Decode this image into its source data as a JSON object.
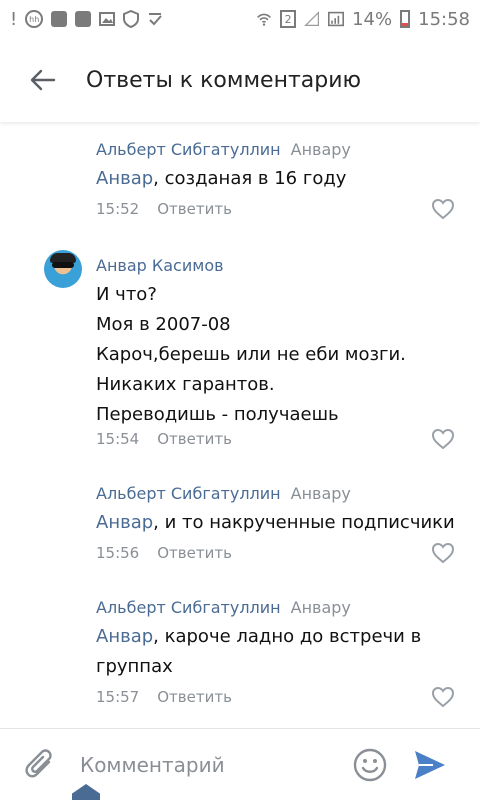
{
  "status_bar": {
    "battery": "14%",
    "time": "15:58",
    "sim": "2",
    "left_icons": [
      "alert-icon",
      "hh-icon",
      "youtube-icon",
      "youtube-icon",
      "image-icon",
      "shield-icon",
      "check-icon"
    ]
  },
  "header": {
    "title": "Ответы к комментарию"
  },
  "comments": [
    {
      "author": "Альберт Сибгатуллин",
      "to": "Анвару",
      "mention": "Анвар",
      "text": ", созданая в 16 году",
      "time": "15:52",
      "reply": "Ответить",
      "has_avatar": false
    },
    {
      "author": "Анвар Касимов",
      "lines": [
        "И что?",
        "Моя в 2007-08",
        "Кароч,берешь или не еби мозги.",
        "Никаких гарантов.",
        "Переводишь - получаешь"
      ],
      "time": "15:54",
      "reply": "Ответить",
      "has_avatar": true
    },
    {
      "author": "Альберт Сибгатуллин",
      "to": "Анвару",
      "mention": "Анвар",
      "text": ", и то накрученные подписчики",
      "time": "15:56",
      "reply": "Ответить",
      "has_avatar": false
    },
    {
      "author": "Альберт Сибгатуллин",
      "to": "Анвару",
      "mention": "Анвар",
      "text": ", кароче ладно до встречи в группах",
      "time": "15:57",
      "reply": "Ответить",
      "has_avatar": false
    }
  ],
  "composer": {
    "placeholder": "Комментарий"
  },
  "colors": {
    "link": "#4a6b94",
    "muted": "#8a8f96",
    "send": "#4a80c8"
  }
}
